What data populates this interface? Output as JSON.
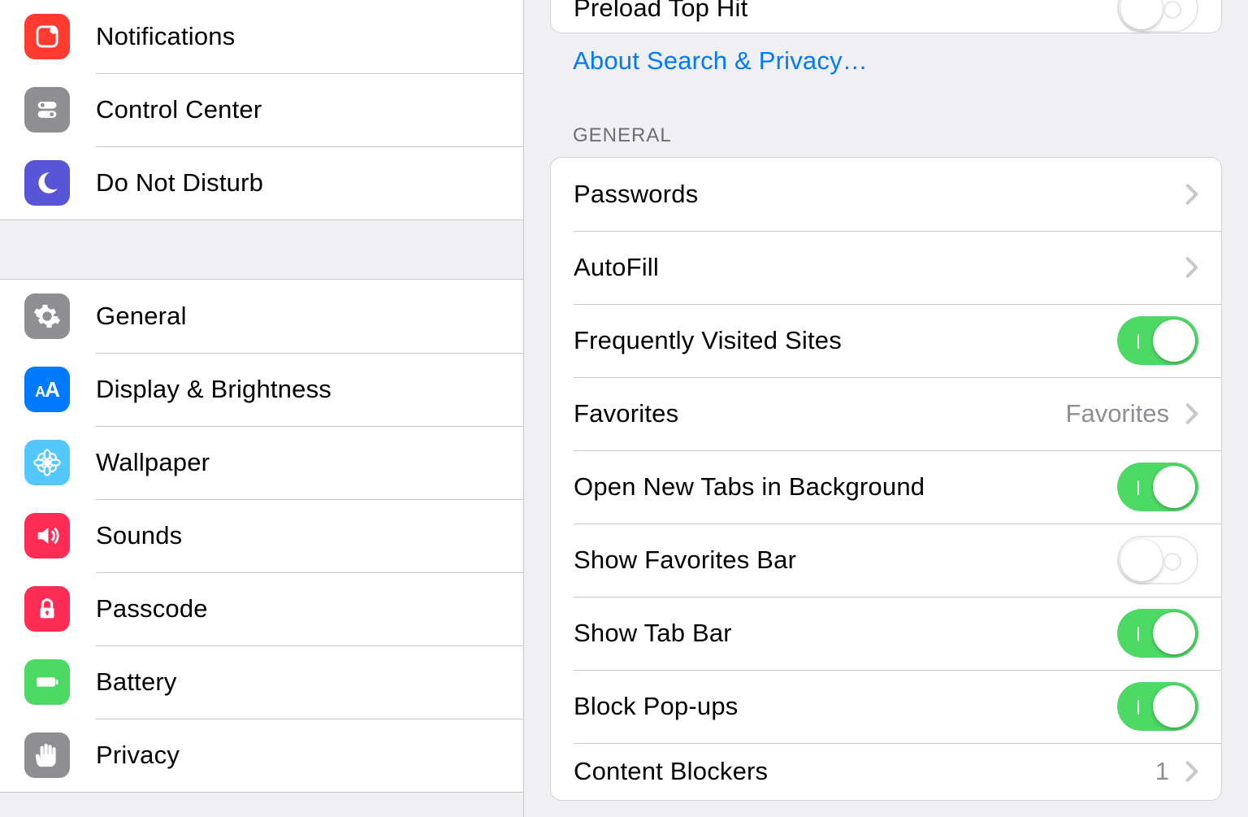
{
  "sidebar": {
    "group1": [
      {
        "id": "notifications",
        "label": "Notifications",
        "icon_bg": "bg-notifications",
        "icon": "notifications-icon"
      },
      {
        "id": "control-center",
        "label": "Control Center",
        "icon_bg": "bg-controlcenter",
        "icon": "control-center-icon"
      },
      {
        "id": "dnd",
        "label": "Do Not Disturb",
        "icon_bg": "bg-dnd",
        "icon": "moon-icon"
      }
    ],
    "group2": [
      {
        "id": "general",
        "label": "General",
        "icon_bg": "bg-general",
        "icon": "gear-icon"
      },
      {
        "id": "display",
        "label": "Display & Brightness",
        "icon_bg": "bg-display",
        "icon": "aa-icon"
      },
      {
        "id": "wallpaper",
        "label": "Wallpaper",
        "icon_bg": "bg-wallpaper",
        "icon": "flower-icon"
      },
      {
        "id": "sounds",
        "label": "Sounds",
        "icon_bg": "bg-sounds",
        "icon": "speaker-icon"
      },
      {
        "id": "passcode",
        "label": "Passcode",
        "icon_bg": "bg-passcode",
        "icon": "lock-icon"
      },
      {
        "id": "battery",
        "label": "Battery",
        "icon_bg": "bg-battery",
        "icon": "battery-icon"
      },
      {
        "id": "privacy",
        "label": "Privacy",
        "icon_bg": "bg-privacy",
        "icon": "hand-icon"
      }
    ]
  },
  "detail": {
    "top_card": {
      "preload_top_hit": {
        "label": "Preload Top Hit",
        "on": false
      }
    },
    "about_link": "About Search & Privacy…",
    "general_header": "GENERAL",
    "general_rows": [
      {
        "kind": "disclosure",
        "label": "Passwords"
      },
      {
        "kind": "disclosure",
        "label": "AutoFill"
      },
      {
        "kind": "toggle",
        "label": "Frequently Visited Sites",
        "on": true
      },
      {
        "kind": "value",
        "label": "Favorites",
        "value": "Favorites"
      },
      {
        "kind": "toggle",
        "label": "Open New Tabs in Background",
        "on": true
      },
      {
        "kind": "toggle",
        "label": "Show Favorites Bar",
        "on": false
      },
      {
        "kind": "toggle",
        "label": "Show Tab Bar",
        "on": true
      },
      {
        "kind": "toggle",
        "label": "Block Pop-ups",
        "on": true
      },
      {
        "kind": "value",
        "label": "Content Blockers",
        "value": "1",
        "partial": true
      }
    ]
  }
}
